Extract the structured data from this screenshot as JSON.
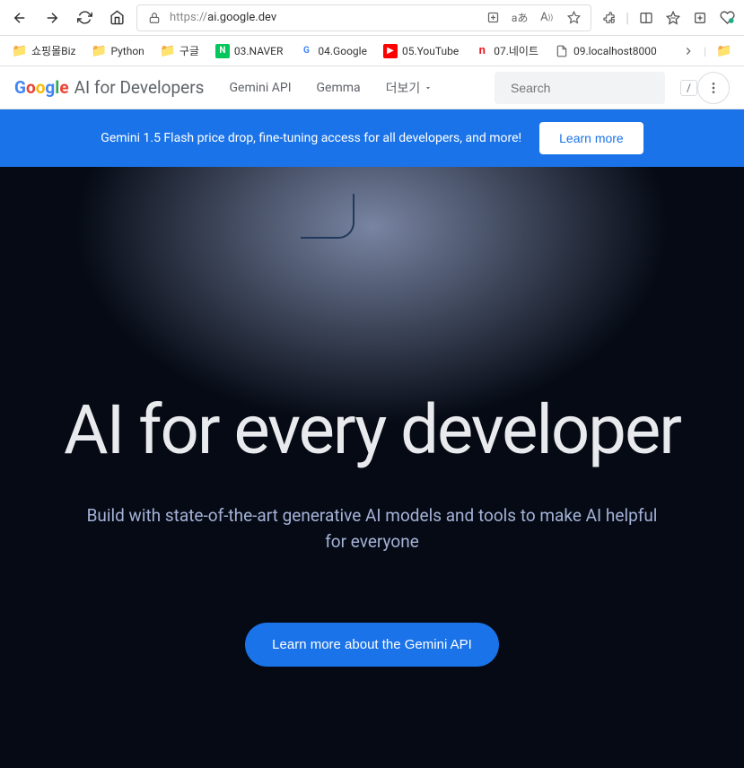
{
  "browser": {
    "url_prefix": "https://",
    "url_host": "ai.google.dev"
  },
  "bookmarks": [
    {
      "label": "쇼핑몰Biz",
      "type": "folder"
    },
    {
      "label": "Python",
      "type": "folder"
    },
    {
      "label": "구글",
      "type": "folder"
    },
    {
      "label": "03.NAVER",
      "type": "naver"
    },
    {
      "label": "04.Google",
      "type": "google"
    },
    {
      "label": "05.YouTube",
      "type": "youtube"
    },
    {
      "label": "07.네이트",
      "type": "nate"
    },
    {
      "label": "09.localhost8000",
      "type": "page"
    }
  ],
  "header": {
    "logo_suffix": "AI for Developers",
    "nav": [
      "Gemini API",
      "Gemma",
      "더보기"
    ],
    "search_placeholder": "Search",
    "kbd_hint": "/"
  },
  "banner": {
    "text": "Gemini 1.5 Flash price drop, fine-tuning access for all developers, and more!",
    "button": "Learn more"
  },
  "hero": {
    "title": "AI for every developer",
    "subtitle": "Build with state-of-the-art generative AI models and tools to make AI helpful for everyone",
    "button": "Learn more about the Gemini API"
  }
}
